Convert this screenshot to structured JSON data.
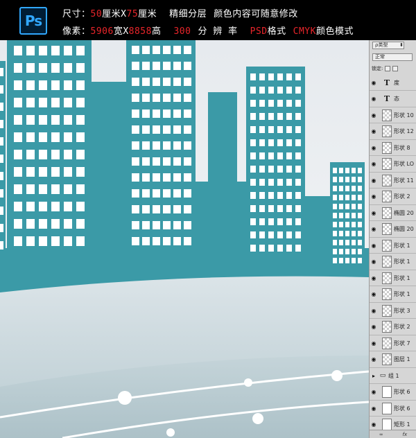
{
  "banner": {
    "logo": "Ps",
    "line1": {
      "size_label": "尺寸：",
      "width_value": "50",
      "width_unit": "厘米X",
      "height_value": "75",
      "height_unit": "厘米",
      "layers_note": "精细分层",
      "edit_note": "颜色内容可随意修改"
    },
    "line2": {
      "pixels_label": "像素：",
      "width_value": "5906",
      "width_unit": "宽X",
      "height_value": "8858",
      "height_unit": "高",
      "resolution_value": "300",
      "resolution_label": "分 辨 率",
      "format_value": "PSD",
      "format_label": "格式",
      "color_value": "CMYK",
      "color_label": "颜色模式"
    }
  },
  "colors": {
    "building": "#3b9aa7",
    "accent_red": "#e8252a",
    "ps_blue": "#31a8ff"
  },
  "layers_panel": {
    "kind_filter": "ρ类型",
    "blend_mode": "正常",
    "lock_label": "锁定:",
    "layers": [
      {
        "name": "度",
        "thumb": "text"
      },
      {
        "name": "态",
        "thumb": "text"
      },
      {
        "name": "形状 10",
        "thumb": "shape"
      },
      {
        "name": "形状 12",
        "thumb": "shape"
      },
      {
        "name": "形状 8",
        "thumb": "shape"
      },
      {
        "name": "形状 LO",
        "thumb": "shape"
      },
      {
        "name": "形状 11",
        "thumb": "shape"
      },
      {
        "name": "形状 2",
        "thumb": "shape"
      },
      {
        "name": "椭圆 20",
        "thumb": "shape"
      },
      {
        "name": "椭圆 20",
        "thumb": "shape"
      },
      {
        "name": "形状 1",
        "thumb": "shape"
      },
      {
        "name": "形状 1",
        "thumb": "shape"
      },
      {
        "name": "形状 1",
        "thumb": "shape"
      },
      {
        "name": "形状 1",
        "thumb": "shape"
      },
      {
        "name": "形状 3",
        "thumb": "shape"
      },
      {
        "name": "形状 2",
        "thumb": "shape"
      },
      {
        "name": "形状 7",
        "thumb": "shape"
      },
      {
        "name": "图层 1",
        "thumb": "shape"
      },
      {
        "name": "组 1",
        "thumb": "group"
      },
      {
        "name": "形状 6",
        "thumb": "white"
      },
      {
        "name": "形状 6",
        "thumb": "white"
      },
      {
        "name": "矩形 1",
        "thumb": "white"
      }
    ],
    "footer_icons": [
      "link-icon",
      "fx-icon"
    ]
  }
}
